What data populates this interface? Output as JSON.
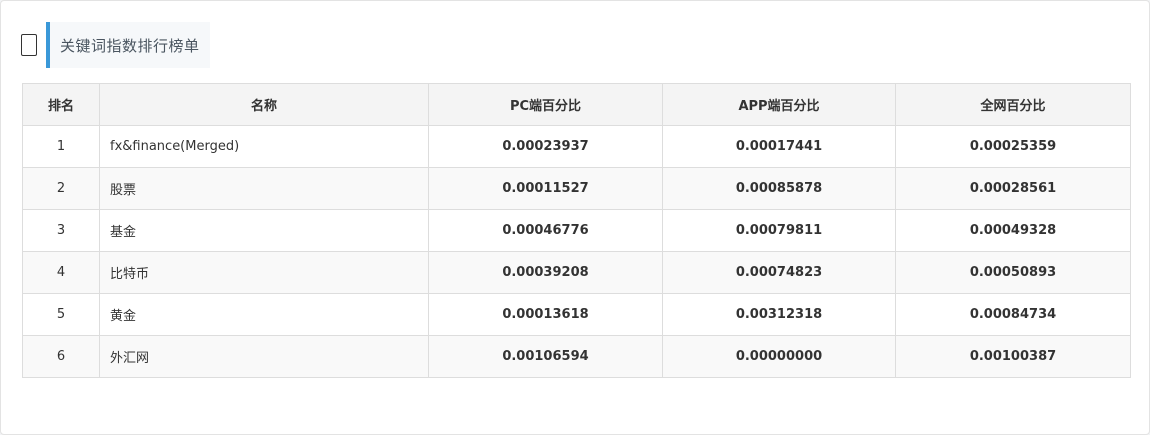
{
  "panel": {
    "title": "关键词指数排行榜单"
  },
  "table": {
    "headers": [
      "排名",
      "名称",
      "PC端百分比",
      "APP端百分比",
      "全网百分比"
    ],
    "rows": [
      {
        "rank": "1",
        "name": "fx&finance(Merged)",
        "pc": "0.00023937",
        "app": "0.00017441",
        "all": "0.00025359"
      },
      {
        "rank": "2",
        "name": "股票",
        "pc": "0.00011527",
        "app": "0.00085878",
        "all": "0.00028561"
      },
      {
        "rank": "3",
        "name": "基金",
        "pc": "0.00046776",
        "app": "0.00079811",
        "all": "0.00049328"
      },
      {
        "rank": "4",
        "name": "比特币",
        "pc": "0.00039208",
        "app": "0.00074823",
        "all": "0.00050893"
      },
      {
        "rank": "5",
        "name": "黄金",
        "pc": "0.00013618",
        "app": "0.00312318",
        "all": "0.00084734"
      },
      {
        "rank": "6",
        "name": "外汇网",
        "pc": "0.00106594",
        "app": "0.00000000",
        "all": "0.00100387"
      }
    ]
  },
  "colors": {
    "accent": "#3a98d8",
    "header_bg": "#f4f4f4",
    "border": "#dddddd"
  },
  "icons": {
    "header_icon": "document-icon"
  }
}
